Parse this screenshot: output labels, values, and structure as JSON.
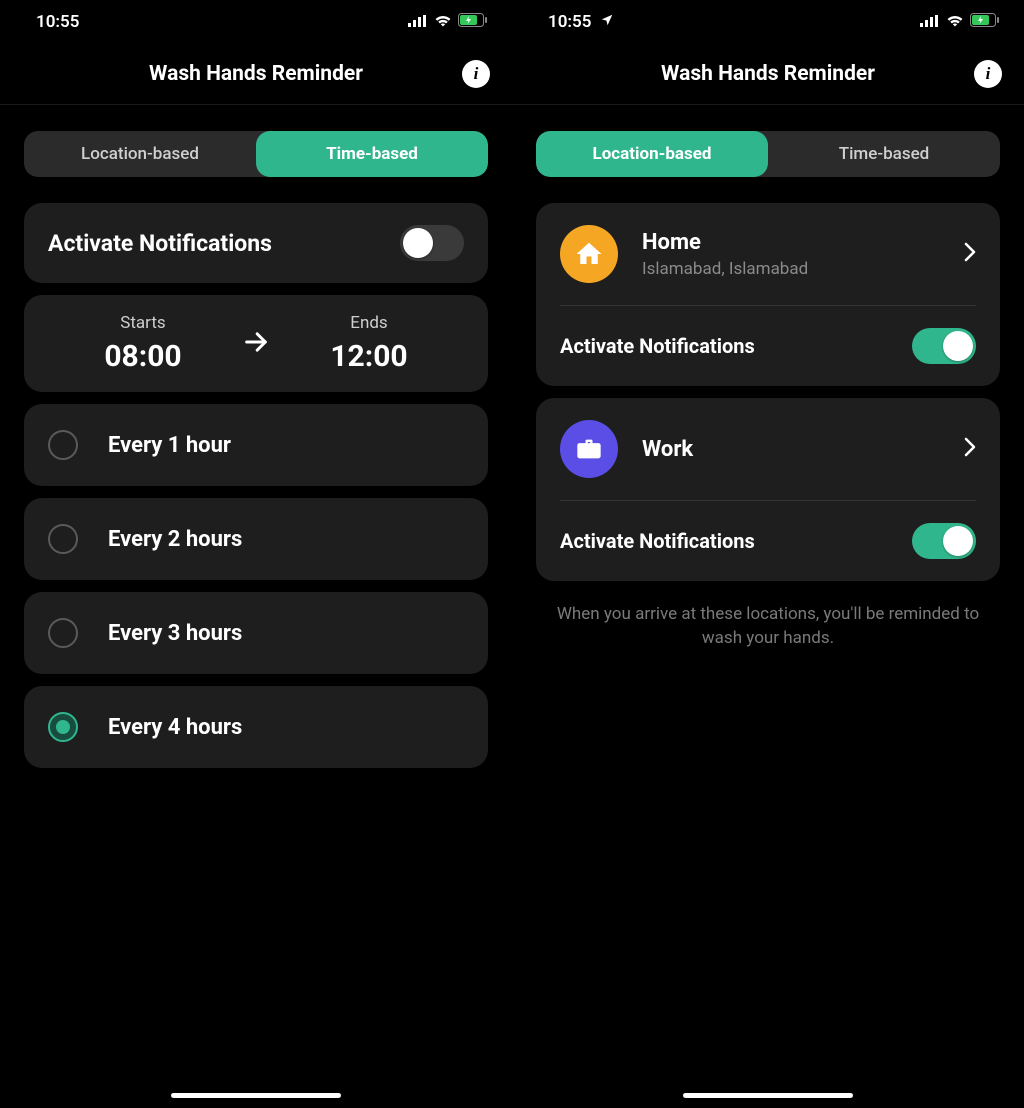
{
  "left": {
    "status_time": "10:55",
    "has_location_arrow": false,
    "nav_title": "Wash Hands Reminder",
    "tabs": {
      "location": "Location-based",
      "time": "Time-based",
      "activeIndex": 1
    },
    "activate_label": "Activate Notifications",
    "activate_on": false,
    "starts_label": "Starts",
    "starts_value": "08:00",
    "ends_label": "Ends",
    "ends_value": "12:00",
    "options": [
      {
        "label": "Every 1 hour",
        "selected": false
      },
      {
        "label": "Every 2 hours",
        "selected": false
      },
      {
        "label": "Every 3 hours",
        "selected": false
      },
      {
        "label": "Every 4 hours",
        "selected": true
      }
    ]
  },
  "right": {
    "status_time": "10:55",
    "has_location_arrow": true,
    "nav_title": "Wash Hands Reminder",
    "tabs": {
      "location": "Location-based",
      "time": "Time-based",
      "activeIndex": 0
    },
    "locations": [
      {
        "icon": "home-icon",
        "title": "Home",
        "subtitle": "Islamabad, Islamabad",
        "activate_label": "Activate Notifications",
        "activate_on": true
      },
      {
        "icon": "briefcase-icon",
        "title": "Work",
        "subtitle": "",
        "activate_label": "Activate Notifications",
        "activate_on": true
      }
    ],
    "hint": "When you arrive at these locations, you'll be reminded to wash your hands."
  }
}
